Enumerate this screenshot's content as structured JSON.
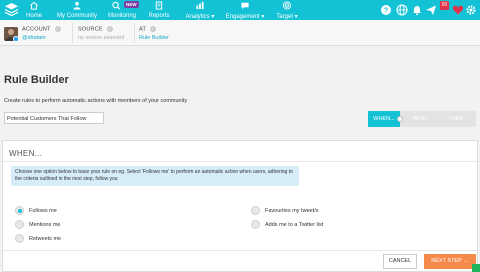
{
  "nav": {
    "items": [
      {
        "label": "Home",
        "icon": "home-icon"
      },
      {
        "label": "My Community",
        "icon": "community-icon"
      },
      {
        "label": "Monitoring",
        "icon": "monitoring-icon",
        "badge": "NEW"
      },
      {
        "label": "Reports",
        "icon": "reports-icon"
      },
      {
        "label": "Analytics",
        "icon": "analytics-icon",
        "dropdown": true
      },
      {
        "label": "Engagement",
        "icon": "engagement-icon",
        "dropdown": true
      },
      {
        "label": "Target",
        "icon": "target-icon",
        "dropdown": true
      }
    ],
    "notification_count": "50",
    "colors": {
      "bar": "#14c2d6",
      "badge_new": "#7b3fa6",
      "badge_count": "#e0334b"
    }
  },
  "account_bar": {
    "account_label": "ACCOUNT",
    "account_value": "@idodam",
    "source_label": "SOURCE",
    "source_value": "no source selected",
    "at_label": "AT",
    "at_value": "Rule Builder"
  },
  "page": {
    "title": "Rule Builder",
    "description": "Create rules to perform automatic actions with members of your community",
    "rule_name": "Potential Customers That Follow"
  },
  "steps": {
    "items": [
      "WHEN...",
      "WITH...",
      "THEN..."
    ],
    "active_index": 0
  },
  "when_panel": {
    "title": "WHEN...",
    "info": "Choose one option below to base your rule on eg. Select 'Follows me' to perform an automatic action when users, adhering to the criteria outlined in the next step, follow you",
    "options_left": [
      {
        "label": "Follows me",
        "selected": true
      },
      {
        "label": "Mentions me",
        "selected": false
      },
      {
        "label": "Retweets me",
        "selected": false
      }
    ],
    "options_right": [
      {
        "label": "Favourites my tweet/s",
        "selected": false
      },
      {
        "label": "Adds me to a Twitter list",
        "selected": false
      }
    ],
    "cancel_label": "CANCEL",
    "next_label": "NEXT STEP →"
  }
}
